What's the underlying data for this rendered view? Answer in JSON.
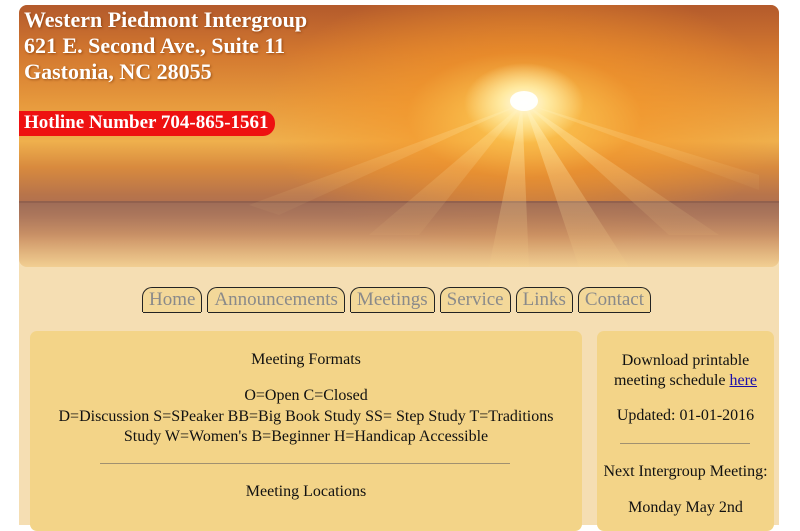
{
  "header": {
    "name": "Western Piedmont Intergroup",
    "address": "621 E. Second Ave., Suite 11",
    "city": "Gastonia, NC 28055",
    "hotline": "Hotline Number 704-865-1561"
  },
  "nav": {
    "items": [
      "Home",
      "Announcements",
      "Meetings",
      "Service",
      "Links",
      "Contact"
    ]
  },
  "main": {
    "formats_title": "Meeting Formats",
    "formats_line1": "O=Open C=Closed",
    "formats_line2": "D=Discussion S=SPeaker BB=Big Book Study SS= Step Study T=Traditions Study W=Women's B=Beginner H=Handicap Accessible",
    "locations_title": "Meeting Locations"
  },
  "side": {
    "download_text": "Download printable meeting schedule",
    "download_link": "here",
    "updated": "Updated: 01-01-2016",
    "next_meeting": "Next Intergroup Meeting:",
    "next_date": "Monday May 2nd"
  },
  "colors": {
    "page_bg": "#f5deb3",
    "panel_bg": "#f3d488",
    "hotline_bg": "#ee1111",
    "link": "#1a0dab"
  }
}
